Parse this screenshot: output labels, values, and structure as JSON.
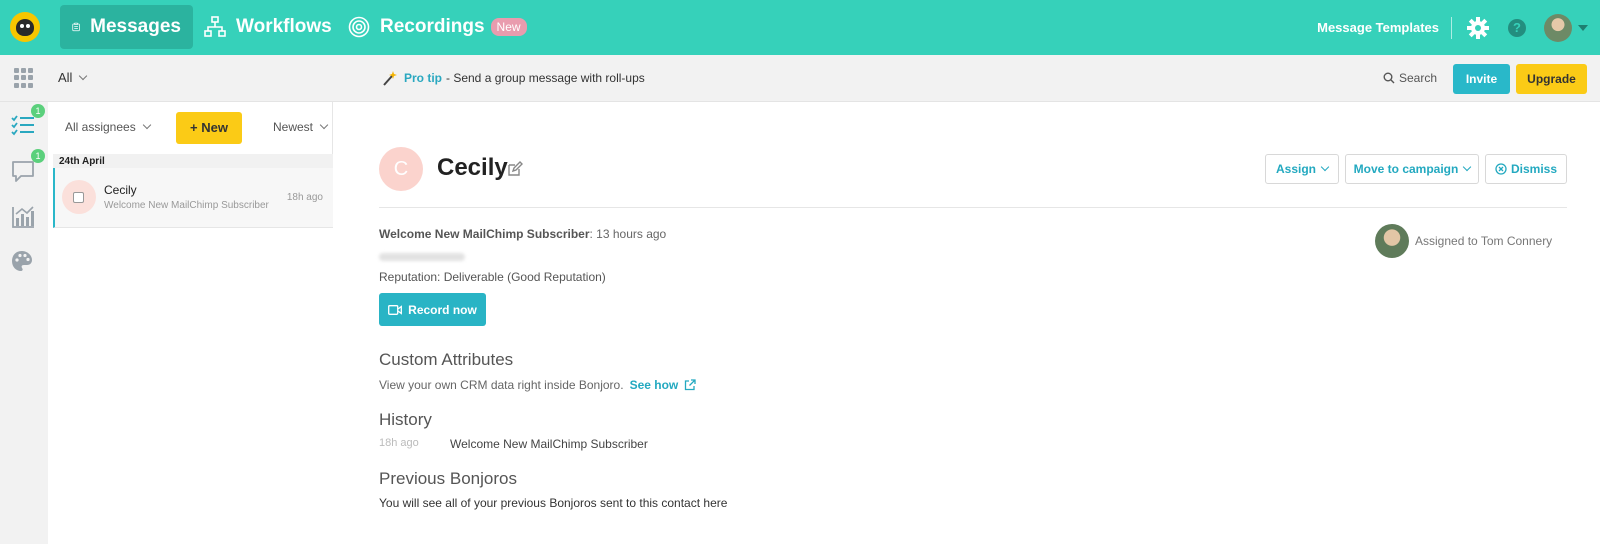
{
  "nav": {
    "items": [
      {
        "label": "Messages",
        "icon": "clipboard-icon",
        "active": true
      },
      {
        "label": "Workflows",
        "icon": "sitemap-icon"
      },
      {
        "label": "Recordings",
        "icon": "spiral-icon",
        "badge": "New"
      }
    ],
    "message_templates": "Message Templates",
    "icons": [
      "gear-icon",
      "help-icon",
      "user-avatar"
    ]
  },
  "subbar": {
    "filter": "All",
    "protip_label": "Pro tip",
    "protip_text": "- Send a group message with roll-ups",
    "search": "Search",
    "invite": "Invite",
    "upgrade": "Upgrade"
  },
  "rail": {
    "items": [
      {
        "icon": "checklist-icon",
        "badge": "1"
      },
      {
        "icon": "chat-icon",
        "badge": "1"
      },
      {
        "icon": "chart-icon"
      },
      {
        "icon": "palette-icon"
      }
    ]
  },
  "list": {
    "assignees": "All assignees",
    "new": "New",
    "sort": "Newest",
    "date_header": "24th April",
    "rows": [
      {
        "name": "Cecily",
        "subtitle": "Welcome New MailChimp Subscriber",
        "time": "18h ago"
      }
    ]
  },
  "detail": {
    "avatar_initial": "C",
    "name": "Cecily",
    "assign": "Assign",
    "move": "Move to campaign",
    "dismiss": "Dismiss",
    "campaign": "Welcome New MailChimp Subscriber",
    "campaign_time": ": 13 hours ago",
    "reputation": "Reputation: Deliverable (Good Reputation)",
    "record": "Record now",
    "assigned_to": "Assigned to Tom Connery",
    "custom_attributes_title": "Custom Attributes",
    "custom_attributes_text": "View your own CRM data right inside Bonjoro.",
    "see_how": "See how",
    "history_title": "History",
    "history_time": "18h ago",
    "history_text": "Welcome New MailChimp Subscriber",
    "previous_title": "Previous Bonjoros",
    "previous_text": "You will see all of your previous Bonjoros sent to this contact here"
  },
  "colors": {
    "brand": "#36d1ba",
    "accent": "#29b8c9",
    "upgrade": "#fbcb16",
    "badge": "#5bd07c"
  }
}
